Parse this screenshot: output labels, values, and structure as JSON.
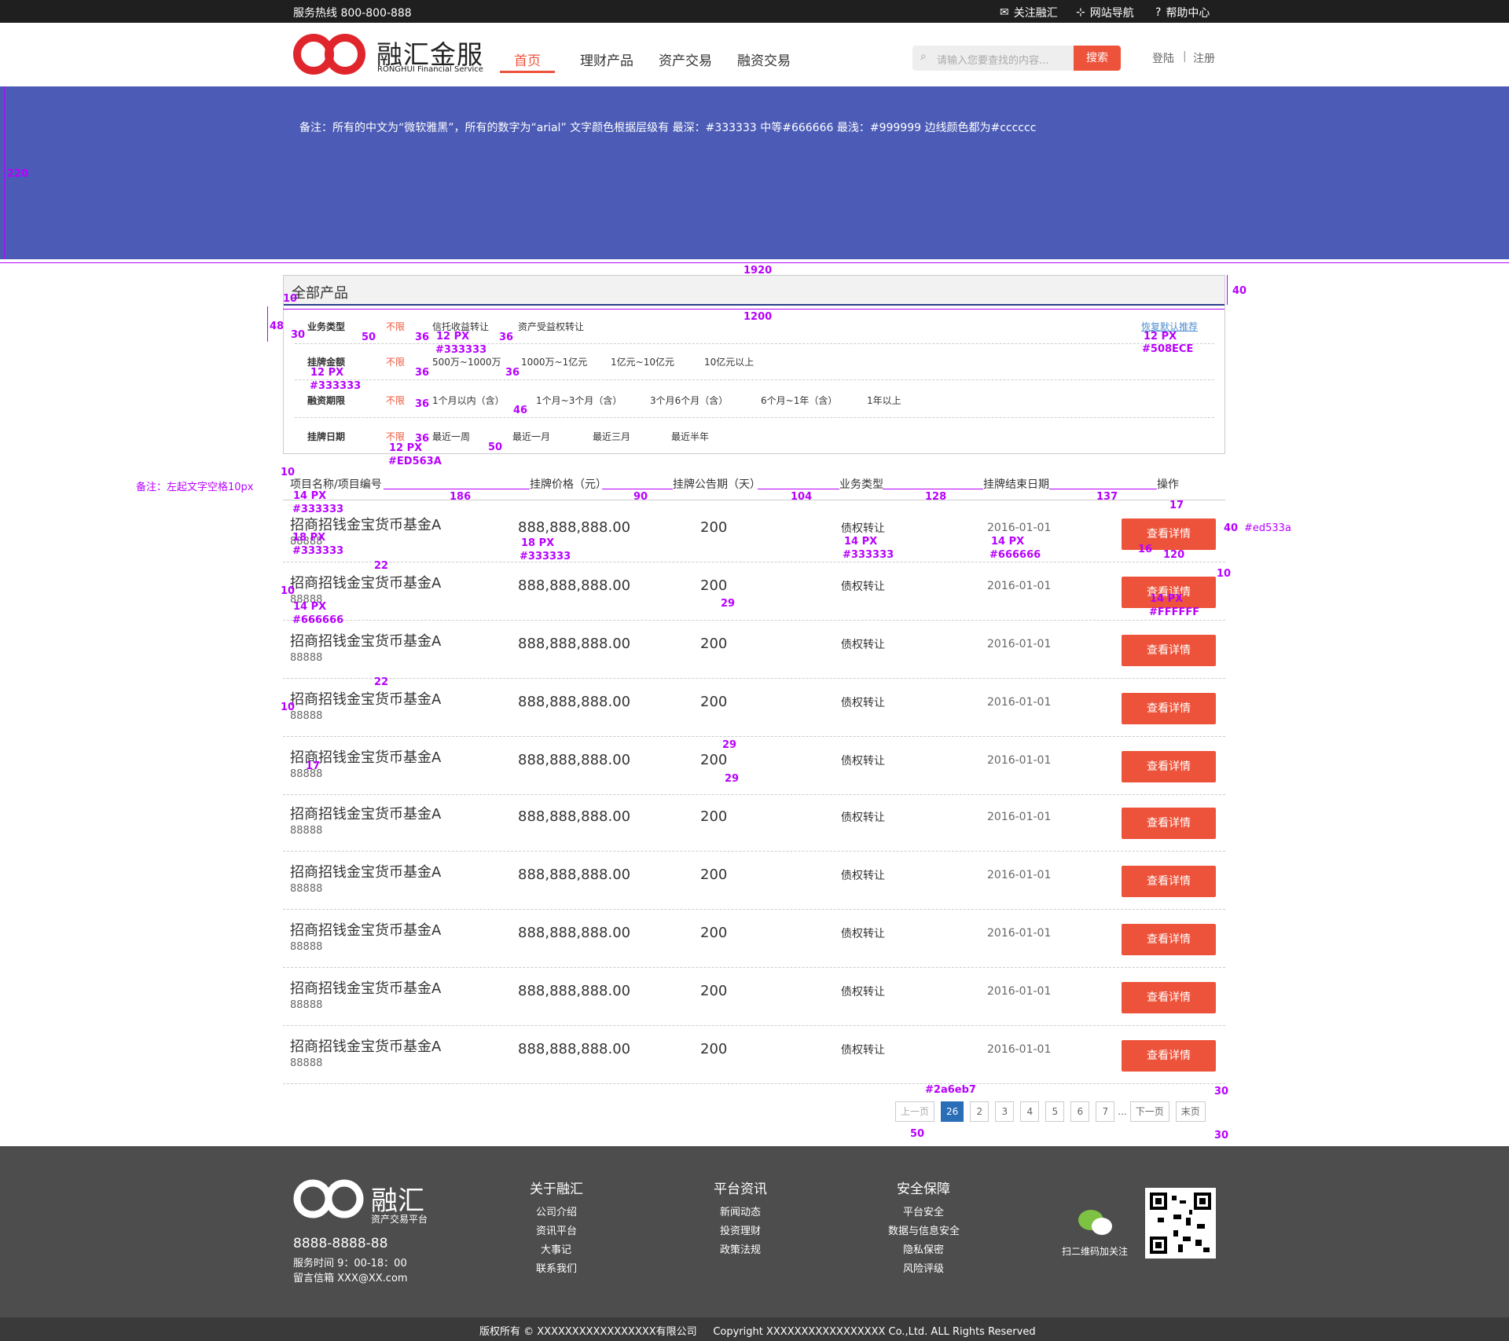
{
  "topbar": {
    "hotline": "服务热线  800-800-888",
    "follow": "关注融汇",
    "sitemap": "网站导航",
    "help": "帮助中心"
  },
  "header": {
    "logo_cn": "融汇金服",
    "logo_en": "RONGHUI Financial Service",
    "nav": [
      "首页",
      "理财产品",
      "资产交易",
      "融资交易"
    ],
    "search_placeholder": "请输入您要查找的内容...",
    "search_btn": "搜索",
    "login": "登陆",
    "sep": "|",
    "register": "注册"
  },
  "banner": {
    "note": "备注：所有的中文为“微软雅黑”，所有的数字为“arial” 文字颜色根据层级有 最深：#333333   中等#666666 最浅：#999999 边线颜色都为#cccccc"
  },
  "filter": {
    "title": "全部产品",
    "restore": "恢复默认推荐",
    "rows": [
      {
        "label": "业务类型",
        "options": [
          "不限",
          "信托收益转让",
          "资产受益权转让"
        ]
      },
      {
        "label": "挂牌金额",
        "options": [
          "不限",
          "500万~1000万",
          "1000万~1亿元",
          "1亿元~10亿元",
          "10亿元以上"
        ]
      },
      {
        "label": "融资期限",
        "options": [
          "不限",
          "1个月以内（含）",
          "1个月~3个月（含）",
          "3个月6个月（含）",
          "6个月~1年（含）",
          "1年以上"
        ]
      },
      {
        "label": "挂牌日期",
        "options": [
          "不限",
          "最近一周",
          "最近一月",
          "最近三月",
          "最近半年"
        ]
      }
    ]
  },
  "table": {
    "headers": [
      "项目名称/项目编号",
      "挂牌价格（元）",
      "挂牌公告期（天）",
      "业务类型",
      "挂牌结束日期",
      "操作"
    ],
    "rows": [
      {
        "name": "招商招钱金宝货币基金A",
        "code": "88888",
        "price": "888,888,888.00",
        "days": "200",
        "type": "债权转让",
        "date": "2016-01-01",
        "action": "查看详情"
      },
      {
        "name": "招商招钱金宝货币基金A",
        "code": "88888",
        "price": "888,888,888.00",
        "days": "200",
        "type": "债权转让",
        "date": "2016-01-01",
        "action": "查看详情"
      },
      {
        "name": "招商招钱金宝货币基金A",
        "code": "88888",
        "price": "888,888,888.00",
        "days": "200",
        "type": "债权转让",
        "date": "2016-01-01",
        "action": "查看详情"
      },
      {
        "name": "招商招钱金宝货币基金A",
        "code": "88888",
        "price": "888,888,888.00",
        "days": "200",
        "type": "债权转让",
        "date": "2016-01-01",
        "action": "查看详情"
      },
      {
        "name": "招商招钱金宝货币基金A",
        "code": "88888",
        "price": "888,888,888.00",
        "days": "200",
        "type": "债权转让",
        "date": "2016-01-01",
        "action": "查看详情"
      },
      {
        "name": "招商招钱金宝货币基金A",
        "code": "88888",
        "price": "888,888,888.00",
        "days": "200",
        "type": "债权转让",
        "date": "2016-01-01",
        "action": "查看详情"
      },
      {
        "name": "招商招钱金宝货币基金A",
        "code": "88888",
        "price": "888,888,888.00",
        "days": "200",
        "type": "债权转让",
        "date": "2016-01-01",
        "action": "查看详情"
      },
      {
        "name": "招商招钱金宝货币基金A",
        "code": "88888",
        "price": "888,888,888.00",
        "days": "200",
        "type": "债权转让",
        "date": "2016-01-01",
        "action": "查看详情"
      },
      {
        "name": "招商招钱金宝货币基金A",
        "code": "88888",
        "price": "888,888,888.00",
        "days": "200",
        "type": "债权转让",
        "date": "2016-01-01",
        "action": "查看详情"
      },
      {
        "name": "招商招钱金宝货币基金A",
        "code": "88888",
        "price": "888,888,888.00",
        "days": "200",
        "type": "债权转让",
        "date": "2016-01-01",
        "action": "查看详情"
      }
    ]
  },
  "pager": {
    "prev": "上一页",
    "pages": [
      "26",
      "2",
      "3",
      "4",
      "5",
      "6",
      "7"
    ],
    "ellipsis": "...",
    "next": "下一页",
    "last": "末页"
  },
  "annotations": {
    "h220": "220",
    "w1920": "1920",
    "w1200": "1200",
    "h40": "40",
    "l10": "10",
    "h48": "48",
    "l30": "30",
    "g50": "50",
    "g36": "36",
    "px12": "12 PX",
    "c333": "#333333",
    "c508": "#508ECE",
    "g46": "46",
    "cED5": "#ED563A",
    "g50b": "50",
    "left_note": "备注：左起文字空格10px",
    "w186": "186",
    "w90": "90",
    "w104": "104",
    "w128": "128",
    "w137": "137",
    "px14": "14 PX",
    "h17": "17",
    "px18": "18 PX",
    "c666": "#666666",
    "h22": "22",
    "h29": "29",
    "cFFF": "#FFFFFF",
    "w16": "16",
    "w120": "120",
    "ced5b": "#ed533a",
    "c2a6": "#2a6eb7",
    "h30": "30"
  },
  "footer": {
    "logo": "融汇",
    "logo_sub": "资产交易平台",
    "phone": "8888-8888-88",
    "hours": "服务时间    9：00-18：00",
    "email": "留言信箱    XXX@XX.com",
    "cols": [
      {
        "title": "关于融汇",
        "links": [
          "公司介绍",
          "资讯平台",
          "大事记",
          "联系我们"
        ]
      },
      {
        "title": "平台资讯",
        "links": [
          "新闻动态",
          "投资理财",
          "政策法规"
        ]
      },
      {
        "title": "安全保障",
        "links": [
          "平台安全",
          "数据与信息安全",
          "隐私保密",
          "风险评级"
        ]
      }
    ],
    "wechat": "扫二维码加关注",
    "copyright": "版权所有 © XXXXXXXXXXXXXXXXX有限公司     Copyright XXXXXXXXXXXXXXXXX Co.,Ltd. ALL Rights Reserved"
  },
  "colors": {
    "accent": "#ed533a",
    "banner": "#4c5cb6",
    "link": "#508ece",
    "page_active": "#2a6eb7",
    "footer": "#4d4d4d",
    "annotation": "#b700ff"
  }
}
